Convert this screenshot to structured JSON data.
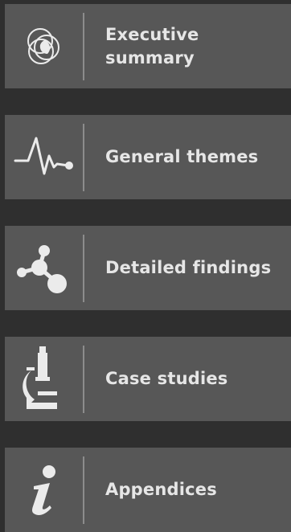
{
  "nav": {
    "items": [
      {
        "label": "Executive\nsummary",
        "icon": "venn-circles-icon"
      },
      {
        "label": "General themes",
        "icon": "pulse-line-icon"
      },
      {
        "label": "Detailed findings",
        "icon": "molecule-icon"
      },
      {
        "label": "Case studies",
        "icon": "microscope-icon"
      },
      {
        "label": "Appendices",
        "icon": "info-icon"
      }
    ]
  },
  "colors": {
    "background": "#2f2f2f",
    "card": "#575757",
    "divider": "#8c8c8c",
    "text": "#e6e6e6",
    "icon": "#ebebeb"
  }
}
